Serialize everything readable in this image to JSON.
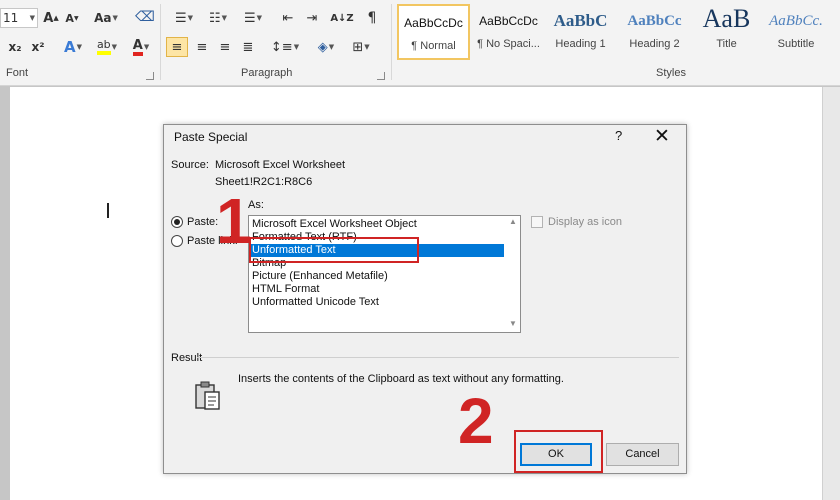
{
  "ribbon": {
    "font_group": {
      "label": "Font",
      "font_size": "11",
      "change_case": "Aa",
      "subscript": "x₂",
      "superscript": "x²",
      "font_color_letter": "A",
      "highlight_letter": "ab"
    },
    "paragraph_group": {
      "label": "Paragraph",
      "sort": "A↓Z",
      "pilcrow": "¶"
    },
    "styles_group": {
      "label": "Styles",
      "items": [
        {
          "sample": "AaBbCcDc",
          "name": "¶ Normal"
        },
        {
          "sample": "AaBbCcDc",
          "name": "¶ No Spaci..."
        },
        {
          "sample": "AaBbC",
          "name": "Heading 1"
        },
        {
          "sample": "AaBbCc",
          "name": "Heading 2"
        },
        {
          "sample": "AaB",
          "name": "Title"
        },
        {
          "sample": "AaBbCc.",
          "name": "Subtitle"
        }
      ]
    }
  },
  "dialog": {
    "title": "Paste Special",
    "help": "?",
    "close": "✕",
    "source_label": "Source:",
    "source_value": "Microsoft Excel Worksheet",
    "source_range": "Sheet1!R2C1:R8C6",
    "paste_option": "Paste:",
    "paste_link_option": "Paste link:",
    "as_label": "As:",
    "as_items": [
      "Microsoft Excel Worksheet Object",
      "Formatted Text (RTF)",
      "Unformatted Text",
      "Bitmap",
      "Picture (Enhanced Metafile)",
      "HTML Format",
      "Unformatted Unicode Text"
    ],
    "selected_item": "Unformatted Text",
    "display_as_icon": "Display as icon",
    "result_label": "Result",
    "result_text": "Inserts the contents of the Clipboard as text without any formatting.",
    "ok_label": "OK",
    "cancel_label": "Cancel"
  },
  "annotations": {
    "step1": "1",
    "step2": "2",
    "color": "#d02424"
  },
  "colors": {
    "accent": "#0078d7",
    "selected_style_border": "#f2c661"
  }
}
